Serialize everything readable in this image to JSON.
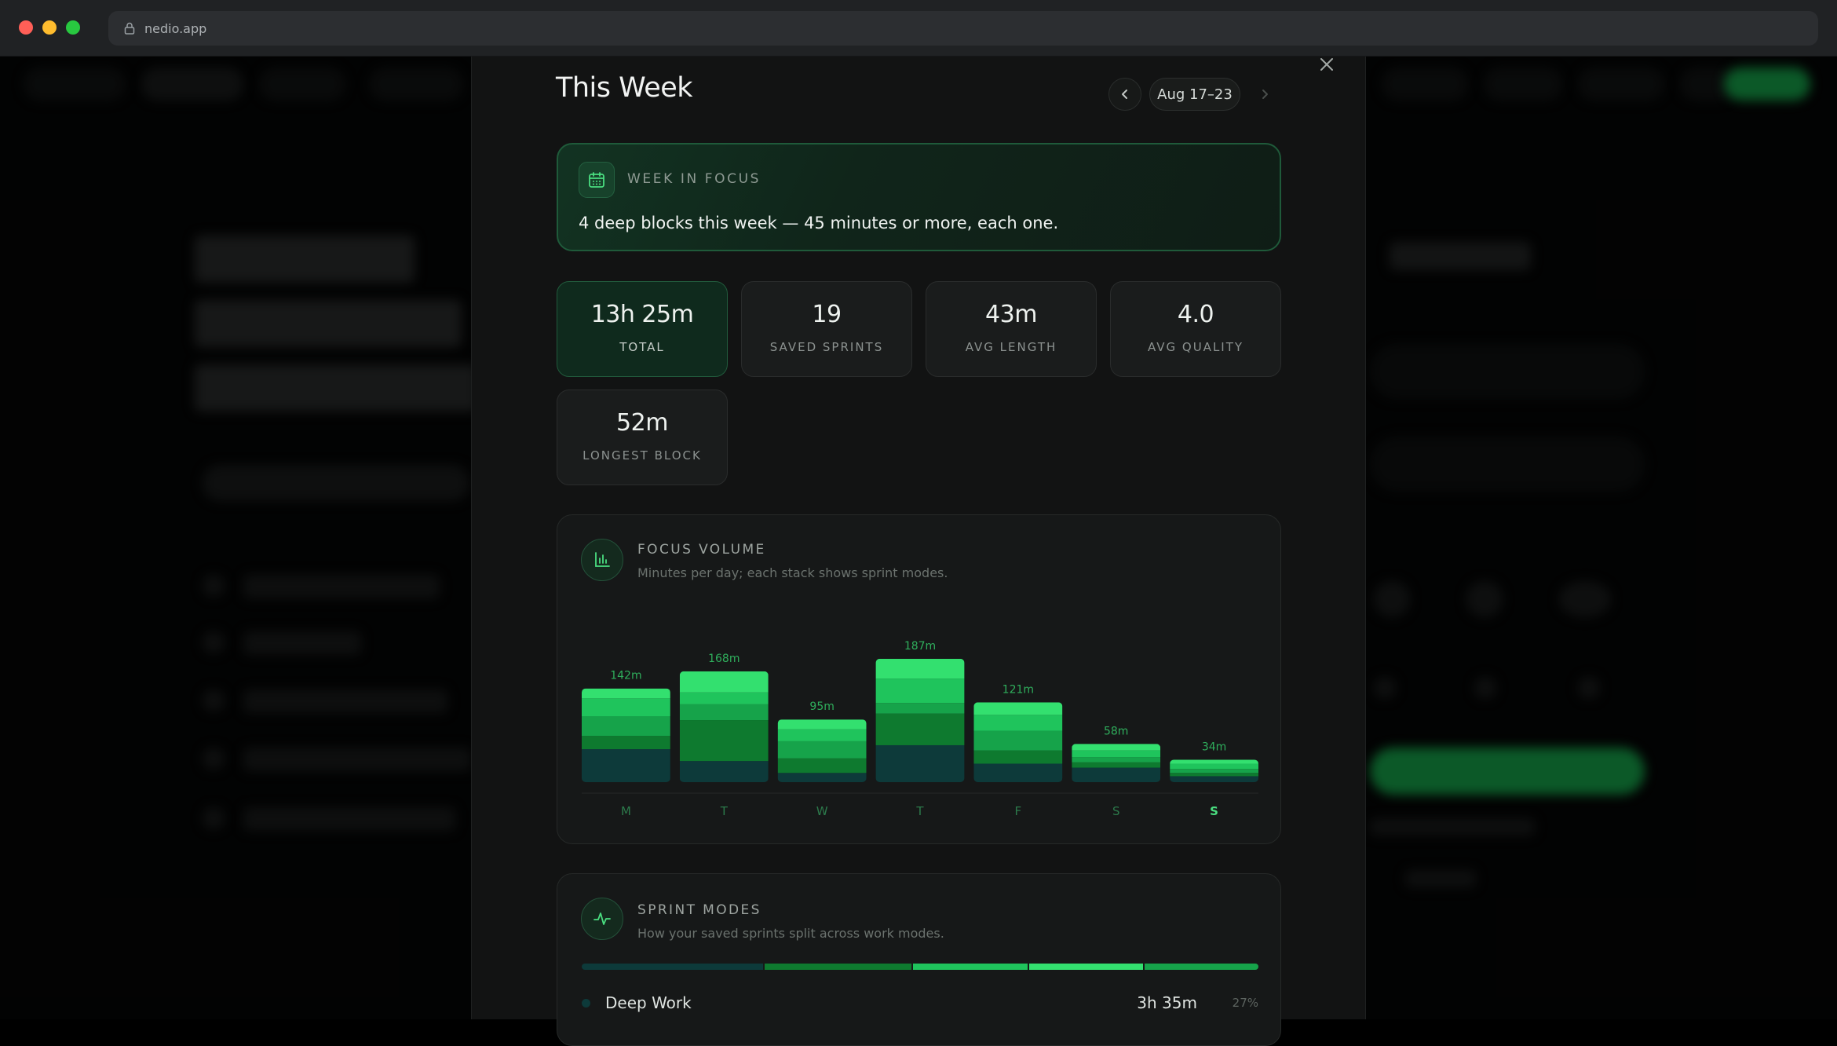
{
  "browser": {
    "url": "nedio.app"
  },
  "modal": {
    "title": "This Week",
    "date_range": "Aug 17–23",
    "close_label": "×"
  },
  "week_focus": {
    "label": "WEEK IN FOCUS",
    "text": "4 deep blocks this week — 45 minutes or more, each one."
  },
  "stats": [
    {
      "value": "13h 25m",
      "label": "TOTAL",
      "active": true
    },
    {
      "value": "19",
      "label": "SAVED SPRINTS",
      "active": false
    },
    {
      "value": "43m",
      "label": "AVG LENGTH",
      "active": false
    },
    {
      "value": "4.0",
      "label": "AVG QUALITY",
      "active": false
    },
    {
      "value": "52m",
      "label": "LONGEST BLOCK",
      "active": false
    }
  ],
  "focus_volume": {
    "title": "FOCUS VOLUME",
    "subtitle": "Minutes per day; each stack shows sprint modes."
  },
  "chart_data": {
    "type": "bar",
    "stacked": true,
    "categories": [
      "M",
      "T",
      "W",
      "T",
      "F",
      "S",
      "S"
    ],
    "totals": [
      142,
      168,
      95,
      187,
      121,
      58,
      34
    ],
    "value_labels": [
      "142m",
      "168m",
      "95m",
      "187m",
      "121m",
      "58m",
      "34m"
    ],
    "highlight_index": 6,
    "ylim": [
      0,
      200
    ],
    "series": [
      {
        "color": "#0d3a3a",
        "values": [
          50,
          32,
          14,
          56,
          28,
          22,
          9
        ]
      },
      {
        "color": "#0e7a2f",
        "values": [
          20,
          62,
          22,
          48,
          20,
          8,
          5
        ]
      },
      {
        "color": "#16a34a",
        "values": [
          30,
          24,
          26,
          16,
          30,
          8,
          6
        ]
      },
      {
        "color": "#1fc45c",
        "values": [
          27,
          18,
          18,
          37,
          24,
          10,
          8
        ]
      },
      {
        "color": "#33e06f",
        "values": [
          15,
          32,
          15,
          30,
          19,
          10,
          6
        ]
      }
    ],
    "grid": false,
    "legend": "none"
  },
  "sprint_modes": {
    "title": "SPRINT MODES",
    "subtitle": "How your saved sprints split across work modes.",
    "bar_segments": [
      {
        "color": "#0d3a3a",
        "share": 27
      },
      {
        "color": "#0e7a2f",
        "share": 22
      },
      {
        "color": "#1fc45c",
        "share": 17
      },
      {
        "color": "#33e06f",
        "share": 17
      },
      {
        "color": "#16a34a",
        "share": 17
      }
    ],
    "rows": [
      {
        "name": "Deep Work",
        "time": "3h 35m",
        "pct": "27%",
        "color": "#0d3a3a"
      }
    ]
  }
}
